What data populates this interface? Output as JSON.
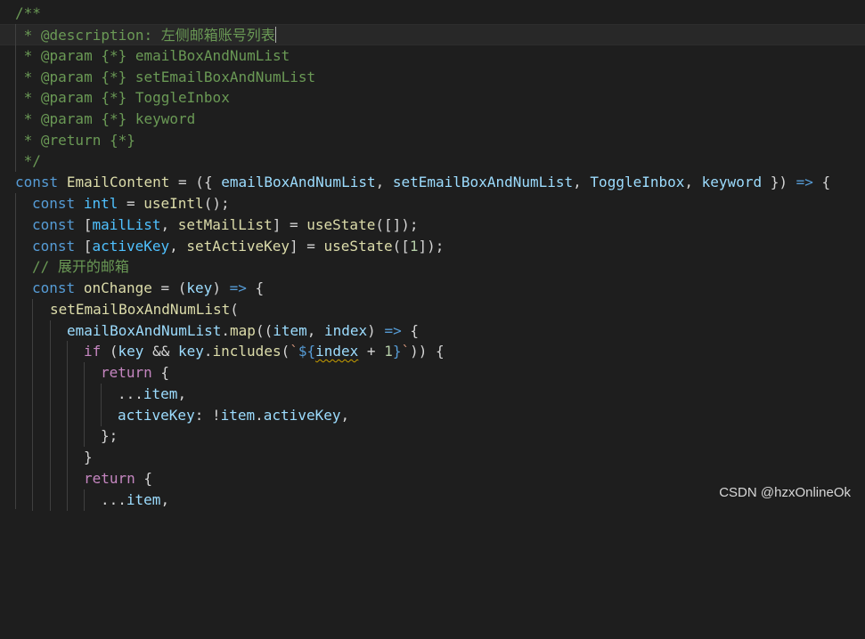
{
  "code_lines": {
    "l1": {
      "c1": "/**"
    },
    "l2": {
      "c1": " * @description: ",
      "c2": "左侧邮箱账号列表"
    },
    "l3": {
      "c1": " * @param {*} emailBoxAndNumList"
    },
    "l4": {
      "c1": " * @param {*} setEmailBoxAndNumList"
    },
    "l5": {
      "c1": " * @param {*} ToggleInbox"
    },
    "l6": {
      "c1": " * @param {*} keyword"
    },
    "l7": {
      "c1": " * @return {*}"
    },
    "l8": {
      "c1": " */"
    },
    "l9": {
      "t1": "const",
      "t2": " ",
      "t3": "EmailContent",
      "t4": " = ({ ",
      "t5": "emailBoxAndNumList",
      "t6": ", ",
      "t7": "setEmailBoxAndNumList",
      "t8": ", ",
      "t9": "ToggleInbox",
      "t10": ", ",
      "t11": "keyword",
      "t12": " }) ",
      "t13": "=>",
      "t14": " {"
    },
    "l10": {
      "t1": "const",
      "t2": " ",
      "t3": "intl",
      "t4": " = ",
      "t5": "useIntl",
      "t6": "();"
    },
    "l11": {
      "t1": "const",
      "t2": " [",
      "t3": "mailList",
      "t4": ", ",
      "t5": "setMailList",
      "t6": "] = ",
      "t7": "useState",
      "t8": "([]);"
    },
    "l12": {
      "t1": "const",
      "t2": " [",
      "t3": "activeKey",
      "t4": ", ",
      "t5": "setActiveKey",
      "t6": "] = ",
      "t7": "useState",
      "t8": "([",
      "t9": "1",
      "t10": "]);"
    },
    "l13": {
      "c1": "// 展开的邮箱"
    },
    "l14": {
      "t1": "const",
      "t2": " ",
      "t3": "onChange",
      "t4": " = (",
      "t5": "key",
      "t6": ") ",
      "t7": "=>",
      "t8": " {"
    },
    "l15": {
      "t1": "setEmailBoxAndNumList",
      "t2": "("
    },
    "l16": {
      "t1": "emailBoxAndNumList",
      "t2": ".",
      "t3": "map",
      "t4": "((",
      "t5": "item",
      "t6": ", ",
      "t7": "index",
      "t8": ") ",
      "t9": "=>",
      "t10": " {"
    },
    "l17": {
      "t1": "if",
      "t2": " (",
      "t3": "key",
      "t4": " && ",
      "t5": "key",
      "t6": ".",
      "t7": "includes",
      "t8": "(",
      "t9": "`",
      "t10": "${",
      "t11": "index",
      "t12": " + ",
      "t13": "1",
      "t14": "}",
      "t15": "`",
      "t16": ")) {"
    },
    "l18": {
      "t1": "return",
      "t2": " {"
    },
    "l19": {
      "t1": "...",
      "t2": "item",
      "t3": ","
    },
    "l20": {
      "t1": "activeKey",
      "t2": ": !",
      "t3": "item",
      "t4": ".",
      "t5": "activeKey",
      "t6": ","
    },
    "l21": {
      "t1": "};"
    },
    "l22": {
      "t1": "}"
    },
    "l23": {
      "t1": "return",
      "t2": " {"
    },
    "l24": {
      "t1": "...",
      "t2": "item",
      "t3": ","
    }
  },
  "watermark": "CSDN @hzxOnlineOk",
  "colors": {
    "background": "#1e1e1e",
    "comment": "#6a9955",
    "keyword": "#569cd6",
    "function": "#dcdcaa",
    "variable": "#9cdcfe",
    "constant": "#4fc1ff",
    "control": "#c586c0",
    "number": "#b5cea8",
    "string": "#ce9178"
  }
}
